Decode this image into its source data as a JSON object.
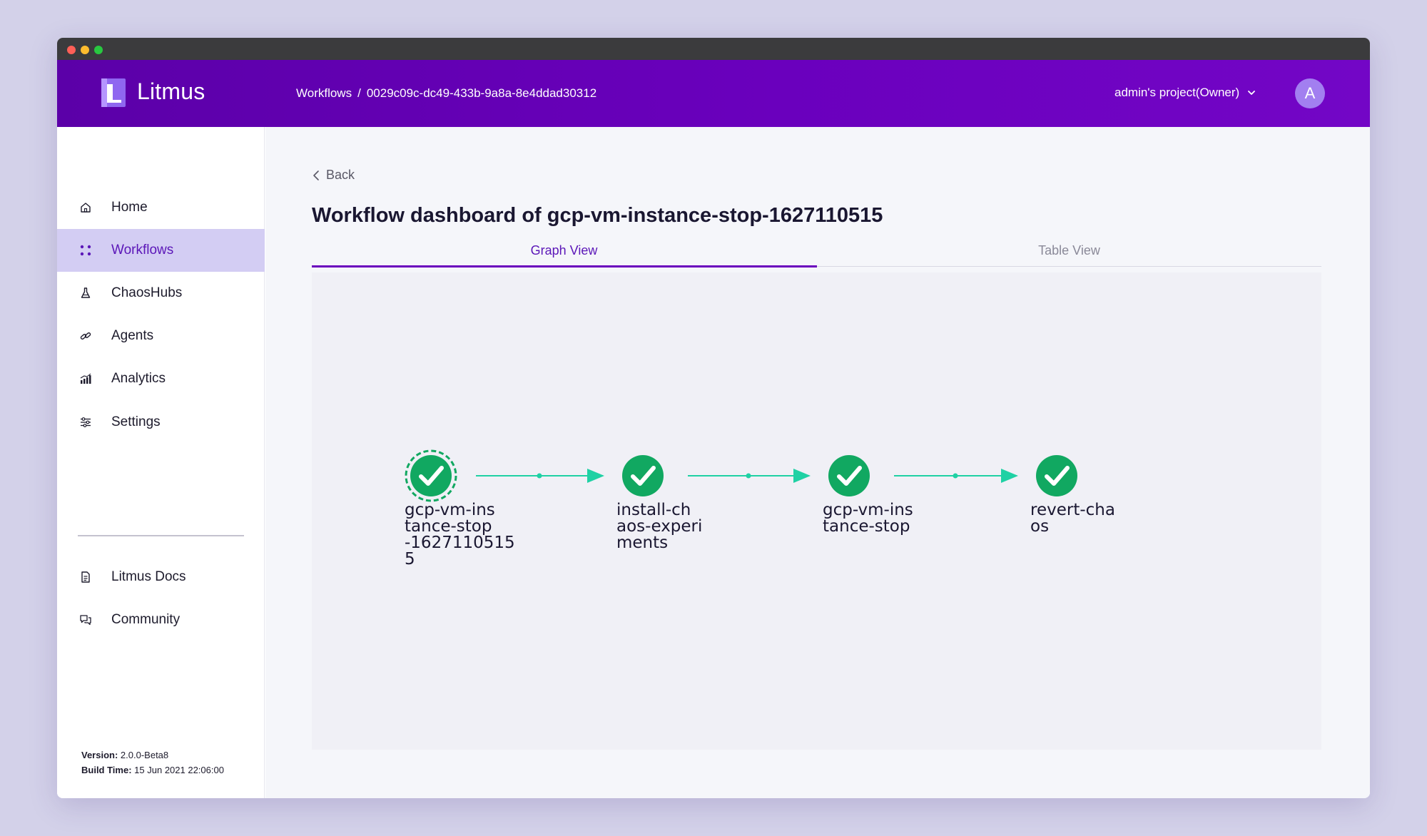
{
  "window": {
    "controls": [
      "close",
      "minimize",
      "maximize"
    ]
  },
  "header": {
    "brand": "Litmus",
    "breadcrumb": {
      "root": "Workflows",
      "separator": "/",
      "current": "0029c09c-dc49-433b-9a8a-8e4ddad30312"
    },
    "project": "admin's project(Owner)",
    "avatar_letter": "A"
  },
  "sidebar": {
    "items": [
      {
        "label": "Home",
        "icon": "home-icon"
      },
      {
        "label": "Workflows",
        "icon": "workflows-grid-icon",
        "active": true
      },
      {
        "label": "ChaosHubs",
        "icon": "flask-icon"
      },
      {
        "label": "Agents",
        "icon": "link-icon"
      },
      {
        "label": "Analytics",
        "icon": "bar-chart-icon"
      },
      {
        "label": "Settings",
        "icon": "sliders-icon"
      },
      {
        "label": "Litmus Docs",
        "icon": "document-icon"
      },
      {
        "label": "Community",
        "icon": "chat-bubbles-icon"
      }
    ],
    "version_label": "Version:",
    "version_value": "2.0.0-Beta8",
    "build_label": "Build Time:",
    "build_value": "15 Jun 2021 22:06:00"
  },
  "main": {
    "back_label": "Back",
    "title": "Workflow dashboard of gcp-vm-instance-stop-1627110515",
    "tabs": [
      {
        "label": "Graph View",
        "active": true
      },
      {
        "label": "Table View",
        "active": false
      }
    ],
    "graph": {
      "nodes": [
        {
          "label": "gcp-vm-ins\ntance-stop\n-1627110515\n5",
          "status": "succeeded",
          "root": true
        },
        {
          "label": "install-ch\naos-experi\nments",
          "status": "succeeded"
        },
        {
          "label": "gcp-vm-ins\ntance-stop",
          "status": "succeeded"
        },
        {
          "label": "revert-cha\nos",
          "status": "succeeded"
        }
      ]
    }
  },
  "colors": {
    "accent": "#6a00bd",
    "success": "#11a861",
    "edge": "#1fd1a4",
    "sidebar_active": "#d3cdf3"
  }
}
